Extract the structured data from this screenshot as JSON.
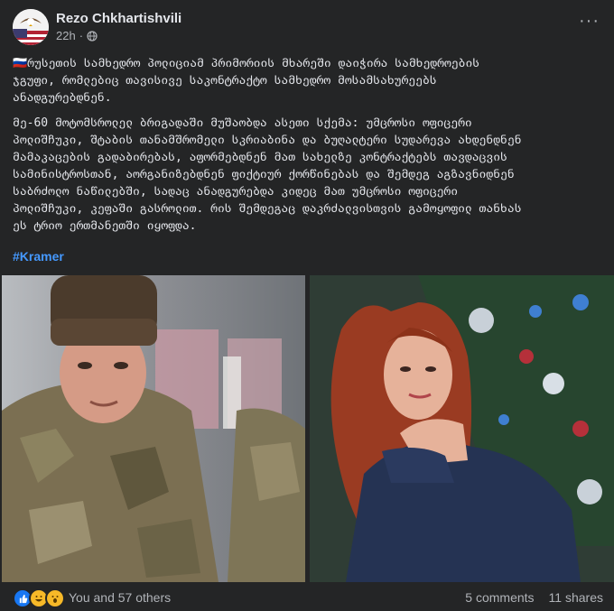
{
  "post": {
    "author": "Rezo Chkhartishvili",
    "time": "22h",
    "privacy_icon": "globe-icon",
    "more_label": "···",
    "paragraph1": [
      "🇷🇺რუსეთის სამხედრო პოლიციამ პრიმორიის მხარეში დაიჭირა სამხედროების",
      "ჯგუფი, რომლებიც თავისივე საკონტრაქტო სამხედრო მოსამსახურეებს",
      "ანადგურებდნენ."
    ],
    "paragraph2": [
      "მე-60 მოტომსროლელ ბრიგადაში მუშაობდა ასეთი სქემა: უმცროსი ოფიცერი",
      "პოლიშჩუკი, შტაბის თანამშრომელი სკრიაბინა და ბუღალტერი სუდარევა ახდენდნენ",
      "მამაკაცების გადაბირებას, აფორმებდნენ მათ სახელზე კონტრაქტებს თავდაცვის",
      "სამინისტროსთან, აორგანიზებდნენ ფიქტიურ ქორწინებას და შემდეგ აგზავნიდნენ",
      "საბრძოლო ნაწილებში, სადაც ანადგურებდა კიდეც მათ უმცროსი ოფიცერი",
      "პოლიშჩუკი, კეფაში გასროლით. რის შემდეგაც დაკრძალვისთვის გამოყოფილ თანხას",
      "ეს ტრიო ერთმანეთში იყოფდა."
    ],
    "hashtag": "#Kramer"
  },
  "footer": {
    "reaction_icons": [
      "like-icon",
      "haha-icon",
      "wow-icon"
    ],
    "likes_text": "You and 57 others",
    "comments_text": "5 comments",
    "shares_text": "11 shares"
  },
  "colors": {
    "background": "#242526",
    "text": "#e4e6eb",
    "secondary_text": "#b0b3b8",
    "link": "#4599ff",
    "like_blue": "#1877f2"
  }
}
